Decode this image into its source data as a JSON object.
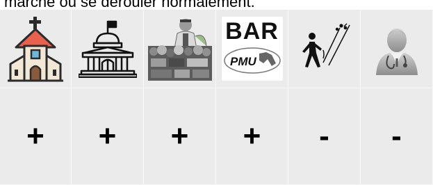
{
  "top_text": "marché ou se dérouler normalement.",
  "icons": [
    {
      "name": "church-icon"
    },
    {
      "name": "town-hall-icon"
    },
    {
      "name": "market-vendor-icon"
    },
    {
      "name": "bar-pmu-logo",
      "label": "BAR",
      "sublabel": "PMU"
    },
    {
      "name": "walking-person-icon"
    },
    {
      "name": "doctor-icon"
    }
  ],
  "signs": [
    "+",
    "+",
    "+",
    "+",
    "-",
    "-"
  ]
}
